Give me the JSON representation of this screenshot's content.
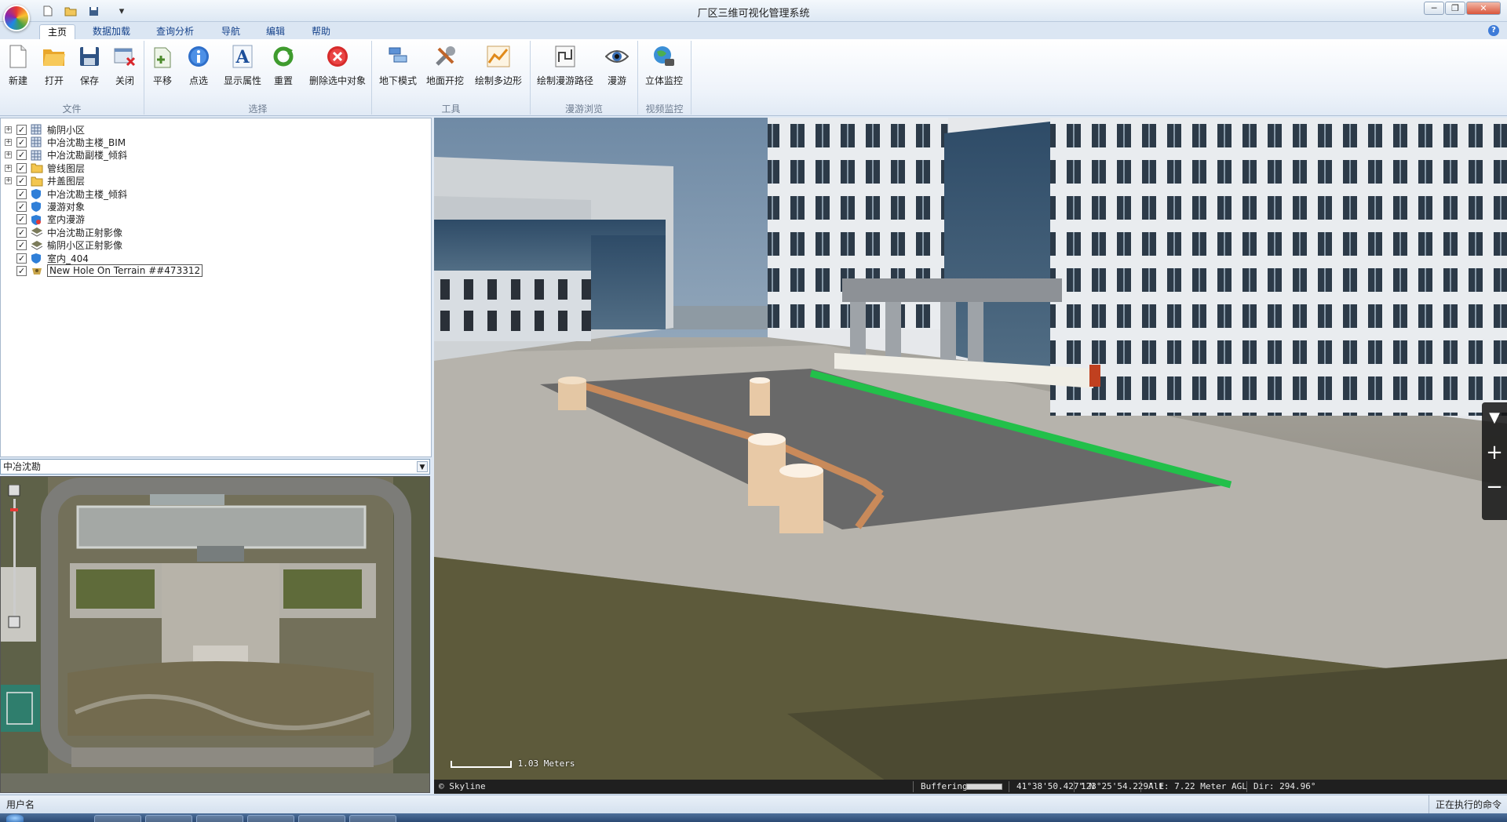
{
  "window": {
    "title": "厂区三维可视化管理系统"
  },
  "quick_access": [
    {
      "name": "new-file-icon",
      "glyph": "🗋"
    },
    {
      "name": "open-folder-icon",
      "glyph": "🗁"
    },
    {
      "name": "save-disk-icon",
      "glyph": "💾"
    },
    {
      "name": "customize-dropdown-icon",
      "glyph": "▾"
    }
  ],
  "window_controls": {
    "minimize": "─",
    "restore": "❐",
    "close": "✕"
  },
  "help_glyph": "?",
  "tabs": [
    {
      "id": "home",
      "label": "主页",
      "active": true
    },
    {
      "id": "data-load",
      "label": "数据加载",
      "active": false
    },
    {
      "id": "query",
      "label": "查询分析",
      "active": false
    },
    {
      "id": "nav",
      "label": "导航",
      "active": false
    },
    {
      "id": "edit",
      "label": "编辑",
      "active": false
    },
    {
      "id": "help",
      "label": "帮助",
      "active": false
    }
  ],
  "ribbon": {
    "groups": {
      "file": "文件",
      "select": "选择",
      "tools": "工具",
      "tour": "漫游浏览",
      "video": "视频监控"
    },
    "buttons": {
      "new": "新建",
      "open": "打开",
      "save": "保存",
      "close": "关闭",
      "pan": "平移",
      "point_select": "点选",
      "show_attr": "显示属性",
      "reset": "重置",
      "delete_selected": "删除选中对象",
      "underground": "地下模式",
      "excavate": "地面开挖",
      "draw_polygon": "绘制多边形",
      "draw_route": "绘制漫游路径",
      "tour": "漫游",
      "stereo_monitor": "立体监控"
    }
  },
  "layer_tree": [
    {
      "label": "榆阴小区",
      "icon": "layer-grid-icon",
      "expandable": true,
      "checked": true,
      "selected": false
    },
    {
      "label": "中冶沈勘主楼_BIM",
      "icon": "layer-grid-icon",
      "expandable": true,
      "checked": true,
      "selected": false
    },
    {
      "label": "中冶沈勘副楼_倾斜",
      "icon": "layer-grid-icon",
      "expandable": true,
      "checked": true,
      "selected": false
    },
    {
      "label": "管线图层",
      "icon": "folder-icon",
      "expandable": true,
      "checked": true,
      "selected": false
    },
    {
      "label": "井盖图层",
      "icon": "folder-icon",
      "expandable": true,
      "checked": true,
      "selected": false
    },
    {
      "label": "中冶沈勘主楼_倾斜",
      "icon": "model-shield-icon",
      "expandable": false,
      "checked": true,
      "selected": false
    },
    {
      "label": "漫游对象",
      "icon": "model-shield-icon",
      "expandable": false,
      "checked": true,
      "selected": false
    },
    {
      "label": "室内漫游",
      "icon": "tour-path-icon",
      "expandable": false,
      "checked": true,
      "selected": false
    },
    {
      "label": "中冶沈勘正射影像",
      "icon": "imagery-stack-icon",
      "expandable": false,
      "checked": true,
      "selected": false
    },
    {
      "label": "榆阴小区正射影像",
      "icon": "imagery-stack-icon",
      "expandable": false,
      "checked": true,
      "selected": false
    },
    {
      "label": "室内_404",
      "icon": "model-shield-icon",
      "expandable": false,
      "checked": true,
      "selected": false
    },
    {
      "label": "New Hole On Terrain ##473312",
      "icon": "terrain-hole-icon",
      "expandable": false,
      "checked": true,
      "selected": true
    }
  ],
  "area_select": {
    "value": "中冶沈勘"
  },
  "viewer": {
    "scale_label": "1.03 Meters",
    "copyright": "© Skyline",
    "buffering": "Buffering",
    "lat": "41°38'50.427\" N",
    "lon": "123°25'54.229\" E",
    "alt": "Alt: 7.22 Meter AGL",
    "dir": "Dir: 294.96°"
  },
  "status": {
    "user": "用户名",
    "command": "正在执行的命令"
  },
  "colors": {
    "ribbon_text": "#15428b",
    "pipe_orange": "#c98a5a",
    "pipe_green": "#22c04a",
    "status_bg": "#1f1f1f"
  }
}
